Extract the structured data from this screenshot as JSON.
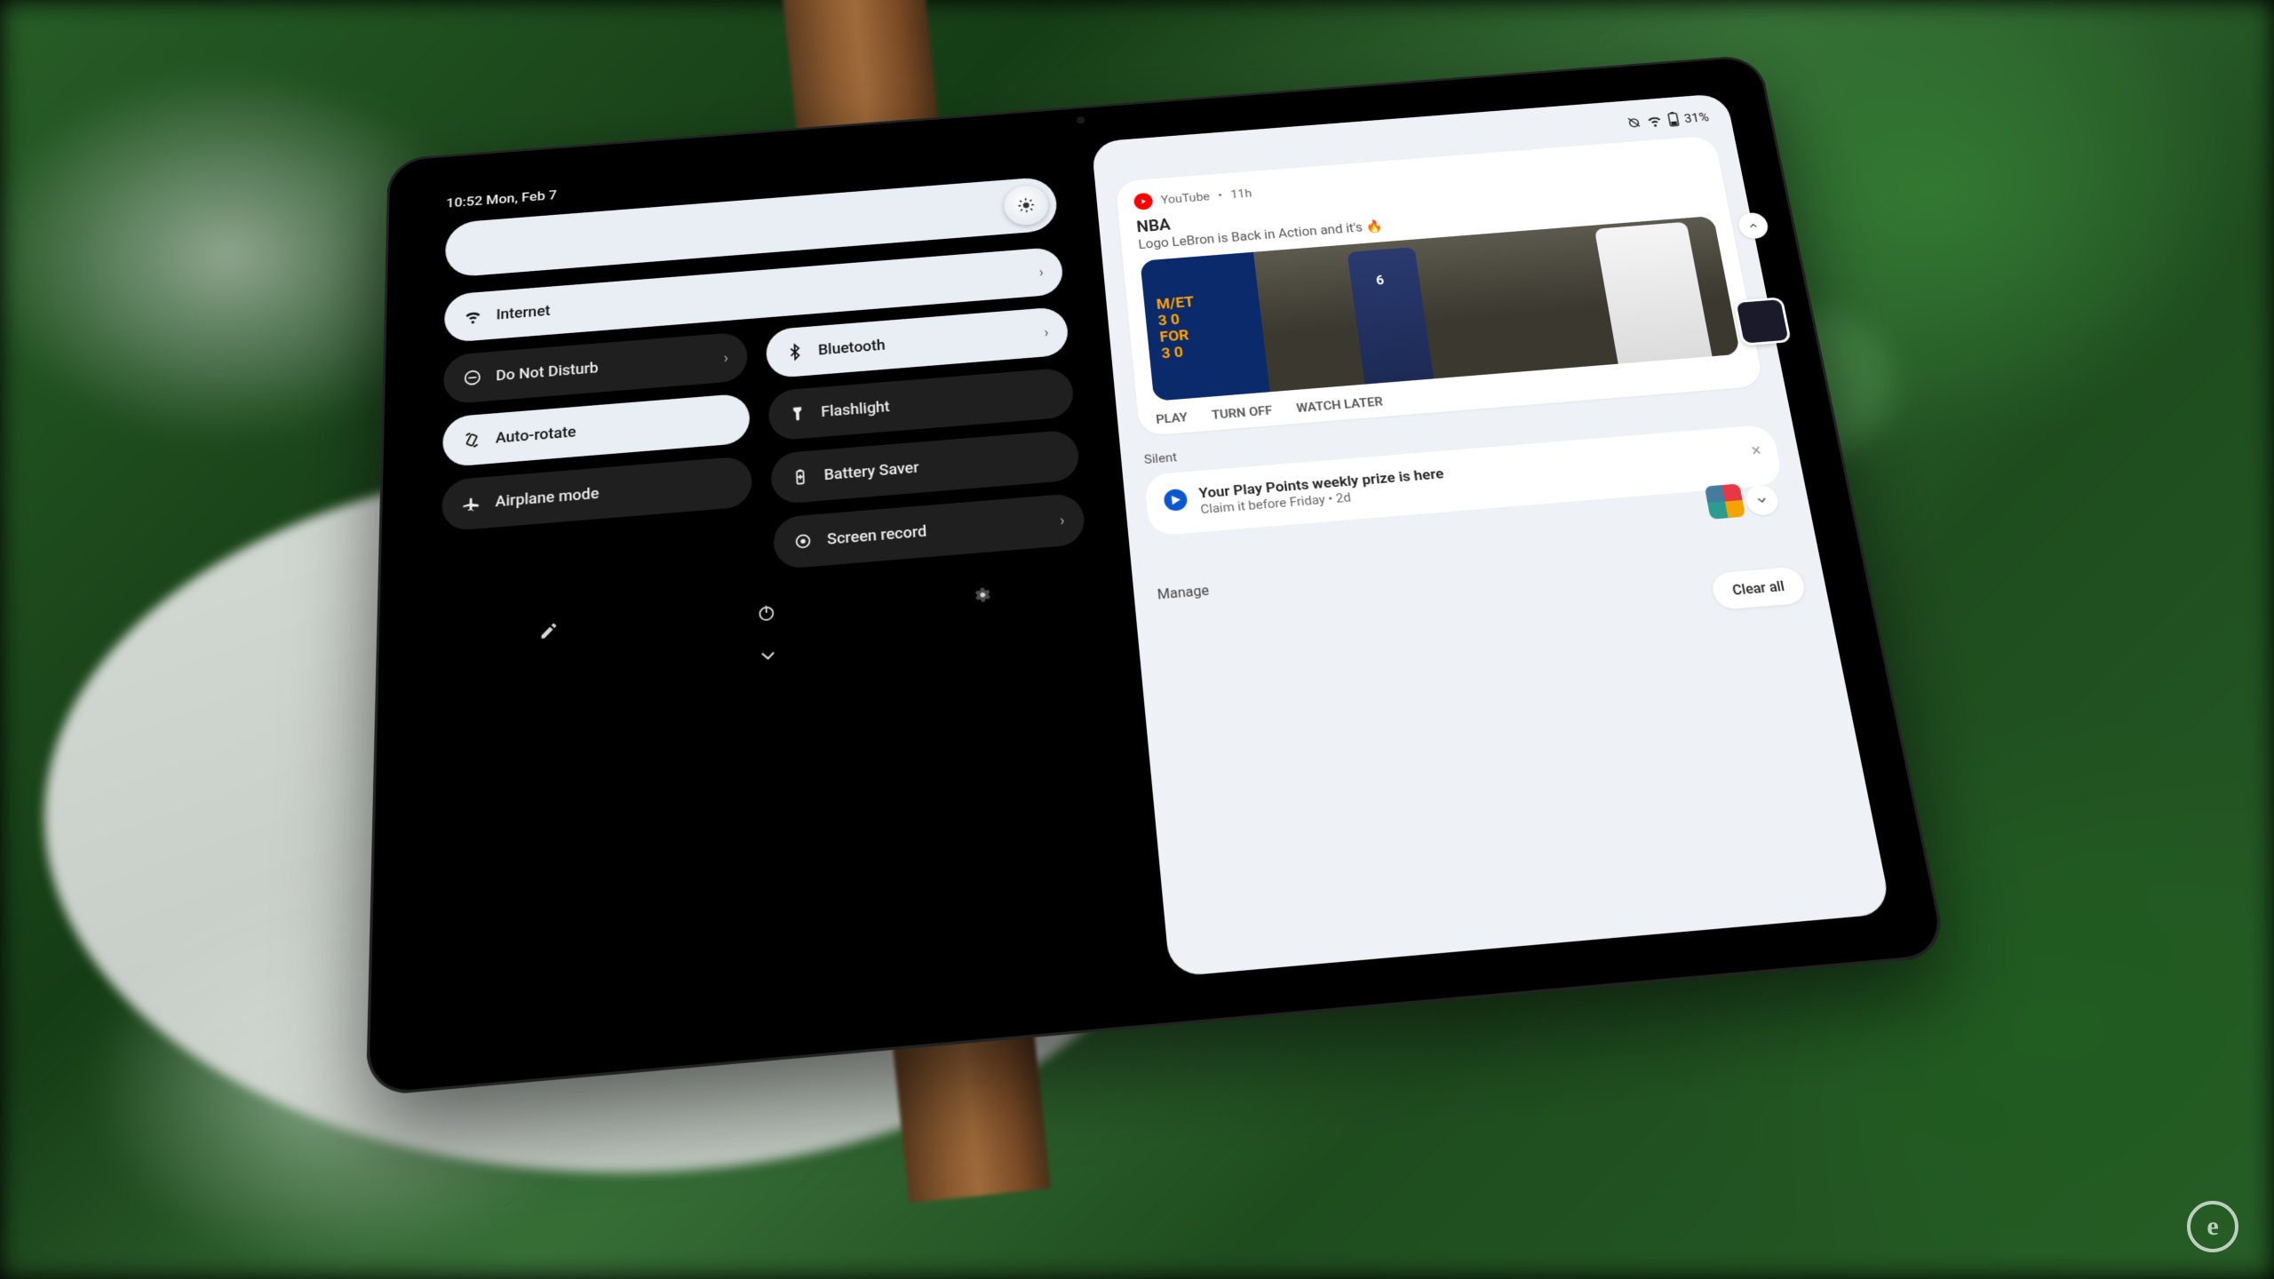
{
  "status_bar": {
    "time": "10:52",
    "date": "Mon, Feb 7",
    "combined": "10:52  Mon, Feb 7"
  },
  "qs": {
    "internet": "Internet",
    "dnd": "Do Not Disturb",
    "bluetooth": "Bluetooth",
    "auto_rotate": "Auto-rotate",
    "flashlight": "Flashlight",
    "airplane": "Airplane mode",
    "battery_saver": "Battery Saver",
    "screen_record": "Screen record"
  },
  "right_status": {
    "battery_text": "31%"
  },
  "notif_youtube": {
    "app": "YouTube",
    "time_ago": "11h",
    "title": "NBA",
    "subtitle": "Logo LeBron is Back in Action and it's 🔥",
    "scoreboard": {
      "line1": "M/ET",
      "line2": "3 0",
      "line3": "FOR",
      "line4": "3 0"
    },
    "actions": {
      "play": "PLAY",
      "turn_off": "TURN OFF",
      "watch_later": "WATCH LATER"
    }
  },
  "section_silent": "Silent",
  "notif_play": {
    "title": "Your Play Points weekly prize is here",
    "subtitle": "Claim it before Friday",
    "time_ago": "2d"
  },
  "manage": "Manage",
  "clear_all": "Clear all"
}
